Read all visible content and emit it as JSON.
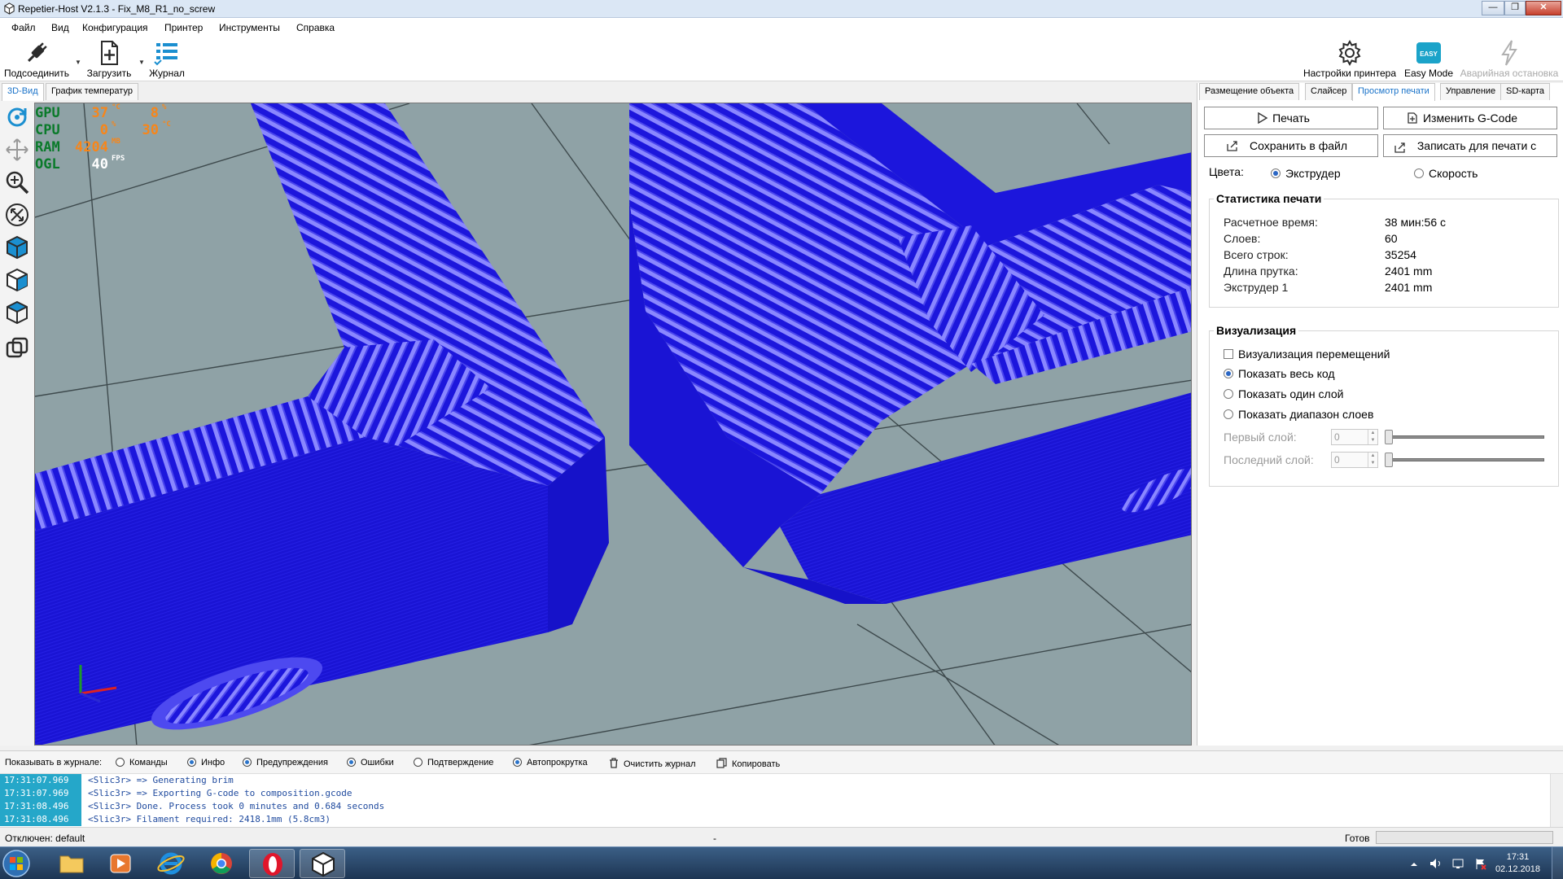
{
  "window": {
    "title": "Repetier-Host V2.1.3 - Fix_M8_R1_no_screw",
    "minimize": "—",
    "restore": "❐",
    "close": "✕"
  },
  "menu": [
    "Файл",
    "Вид",
    "Конфигурация",
    "Принтер",
    "Инструменты",
    "Справка"
  ],
  "toolbar": {
    "connect": "Подсоединить",
    "load": "Загрузить",
    "log": "Журнал",
    "printer_settings": "Настройки принтера",
    "easy_mode": "Easy Mode",
    "easy_badge": "EASY",
    "emergency": "Аварийная остановка"
  },
  "left_tabs": [
    "3D-Вид",
    "График температур"
  ],
  "hud": {
    "gpu": {
      "label": "GPU",
      "temp": "37",
      "temp_unit": "°C",
      "load": "8",
      "load_unit": "%"
    },
    "cpu": {
      "label": "CPU",
      "temp": "0",
      "temp_unit": "%",
      "load": "30",
      "load_unit": "°C"
    },
    "ram": {
      "label": "RAM",
      "value": "4204",
      "unit": "MB"
    },
    "ogl": {
      "label": "OGL",
      "value": "40",
      "unit": "FPS"
    }
  },
  "colors": {
    "accent": "#1a73c9",
    "model": "#1a14d9",
    "bed": "#8fa2a6",
    "log_time_bg": "#25a7c9"
  },
  "right_tabs": [
    "Размещение объекта",
    "Слайсер",
    "Просмотр печати",
    "Управление",
    "SD-карта"
  ],
  "right_active_tab": 2,
  "preview": {
    "print_btn": "Печать",
    "edit_gcode_btn": "Изменить G-Code",
    "save_file_btn": "Сохранить в файл",
    "write_sd_btn": "Записать для печати с",
    "colors_label": "Цвета:",
    "color_extruder": "Экструдер",
    "color_speed": "Скорость",
    "stats_title": "Статистика печати",
    "stats": [
      {
        "k": "Расчетное время:",
        "v": "38 мин:56 с"
      },
      {
        "k": "Слоев:",
        "v": "60"
      },
      {
        "k": "Всего строк:",
        "v": "35254"
      },
      {
        "k": "Длина прутка:",
        "v": "2401 mm"
      },
      {
        "k": "Экструдер 1",
        "v": "2401 mm"
      }
    ],
    "vis_title": "Визуализация",
    "vis_moves": "Визуализация перемещений",
    "vis_all": "Показать весь код",
    "vis_single": "Показать один слой",
    "vis_range": "Показать диапазон слоев",
    "first_layer": "Первый слой:",
    "last_layer": "Последний слой:",
    "first_value": "0",
    "last_value": "0"
  },
  "logbar": {
    "show_in_log": "Показывать в журнале:",
    "commands": "Команды",
    "info": "Инфо",
    "warnings": "Предупреждения",
    "errors": "Ошибки",
    "ack": "Подтверждение",
    "autoscroll": "Автопрокрутка",
    "clear": "Очистить журнал",
    "copy": "Копировать"
  },
  "log": [
    {
      "t": "17:31:07.969",
      "m": "<Slic3r> => Generating brim"
    },
    {
      "t": "17:31:07.969",
      "m": "<Slic3r> => Exporting G-code to composition.gcode"
    },
    {
      "t": "17:31:08.496",
      "m": "<Slic3r> Done. Process took 0 minutes and 0.684 seconds"
    },
    {
      "t": "17:31:08.496",
      "m": "<Slic3r> Filament required: 2418.1mm (5.8cm3)"
    }
  ],
  "status": {
    "left": "Отключен: default",
    "mid": "-",
    "right": "Готов"
  },
  "clock": {
    "time": "17:31",
    "date": "02.12.2018"
  }
}
